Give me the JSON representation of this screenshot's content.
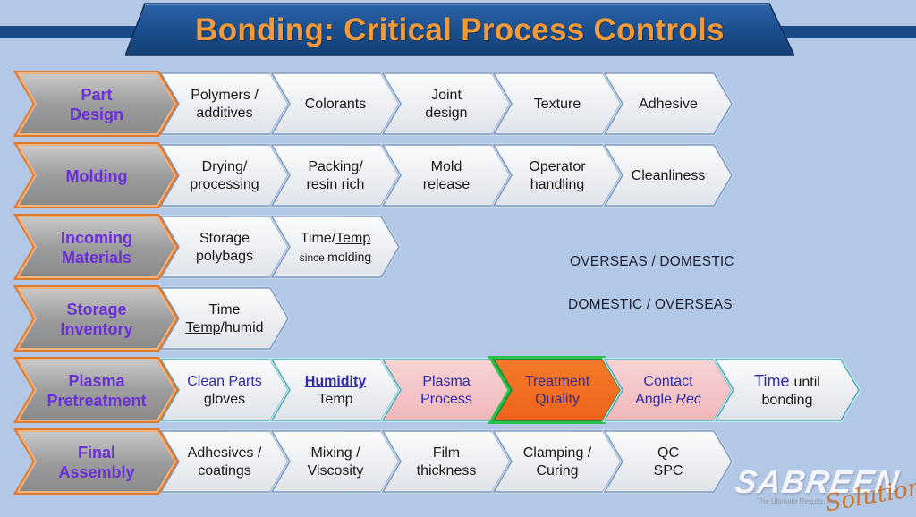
{
  "title": "Bonding: Critical Process Controls",
  "colors": {
    "background": "#b3c7e6",
    "title_banner": "#1b4f8f",
    "title_text": "#f29a3a",
    "header_outline": "#e07a2e",
    "header_text": "#6a2fd6",
    "item_fill": "#eef0f4",
    "item_outline": "#8fa8c8",
    "plasma_pink": "#f4c4c6",
    "treatment_orange": "#f26d1f",
    "treatment_outline": "#2ec24a"
  },
  "rows": [
    {
      "header": [
        "Part",
        "Design"
      ],
      "items": [
        {
          "lines": [
            "Polymers /",
            "additives"
          ]
        },
        {
          "lines": [
            "Colorants"
          ]
        },
        {
          "lines": [
            "Joint",
            "design"
          ]
        },
        {
          "lines": [
            "Texture"
          ]
        },
        {
          "lines": [
            "Adhesive"
          ]
        }
      ]
    },
    {
      "header": [
        "Molding"
      ],
      "items": [
        {
          "lines": [
            "Drying/",
            "processing"
          ]
        },
        {
          "lines": [
            "Packing/",
            "resin rich"
          ]
        },
        {
          "lines": [
            "Mold",
            "release"
          ]
        },
        {
          "lines": [
            "Operator",
            "handling"
          ]
        },
        {
          "lines": [
            "Cleanliness"
          ]
        }
      ]
    },
    {
      "header": [
        "Incoming",
        "Materials"
      ],
      "items": [
        {
          "lines": [
            "Storage",
            "polybags"
          ]
        },
        {
          "lines": [
            "Time/Temp",
            "since molding"
          ]
        }
      ]
    },
    {
      "header": [
        "Storage",
        "Inventory"
      ],
      "items": [
        {
          "lines": [
            "Time",
            "Temp/humid"
          ]
        }
      ]
    },
    {
      "header": [
        "Plasma",
        "Pretreatment"
      ],
      "items": [
        {
          "lines": [
            "Clean Parts",
            "gloves"
          ]
        },
        {
          "lines": [
            "Humidity",
            "Temp"
          ]
        },
        {
          "lines": [
            "Plasma",
            "Process"
          ]
        },
        {
          "lines": [
            "Treatment",
            "Quality"
          ]
        },
        {
          "lines": [
            "Contact",
            "Angle Rec"
          ]
        },
        {
          "lines": [
            "Time until",
            "bonding"
          ]
        }
      ]
    },
    {
      "header": [
        "Final",
        "Assembly"
      ],
      "items": [
        {
          "lines": [
            "Adhesives /",
            "coatings"
          ]
        },
        {
          "lines": [
            "Mixing /",
            "Viscosity"
          ]
        },
        {
          "lines": [
            "Film",
            "thickness"
          ]
        },
        {
          "lines": [
            "Clamping /",
            "Curing"
          ]
        },
        {
          "lines": [
            "QC",
            "SPC"
          ]
        }
      ]
    }
  ],
  "notes": {
    "note1": "OVERSEAS / DOMESTIC",
    "note2": "DOMESTIC / OVERSEAS"
  },
  "logo": {
    "main": "SABREEN",
    "script": "Solutions",
    "tagline": "The Ultimate Results, Inc."
  }
}
